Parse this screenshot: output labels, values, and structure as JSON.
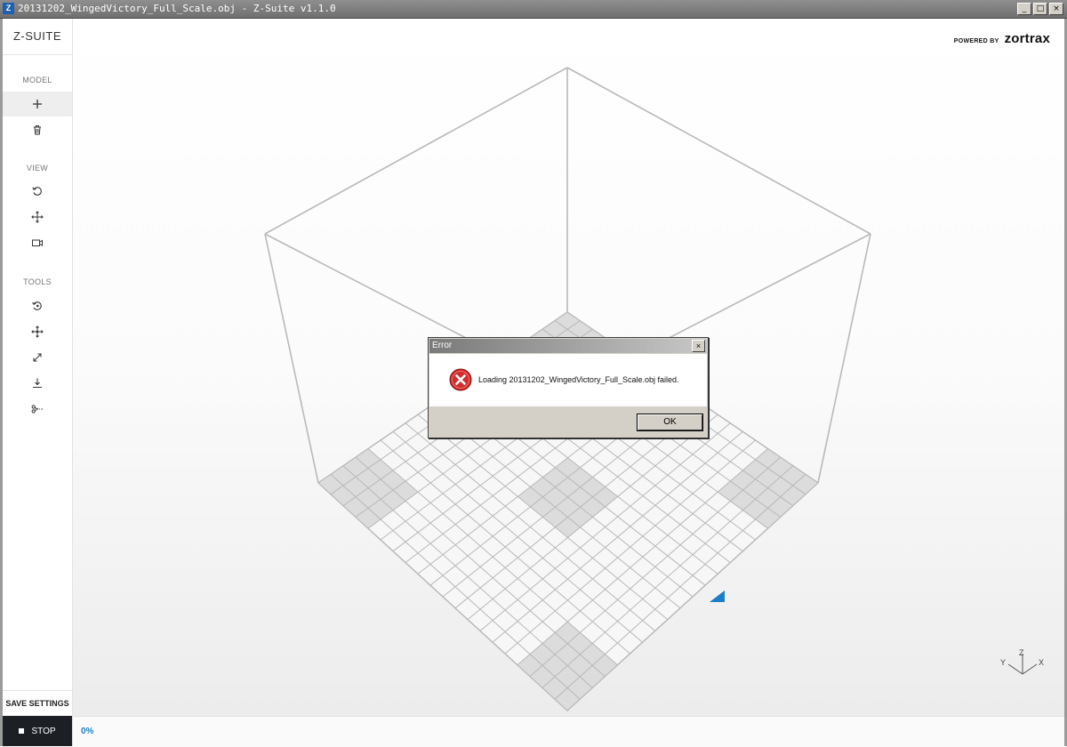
{
  "window": {
    "app_icon_letter": "Z",
    "title": "20131202_WingedVictory_Full_Scale.obj - Z-Suite v1.1.0",
    "minimize_glyph": "_",
    "maximize_glyph": "□",
    "close_glyph": "×"
  },
  "sidebar": {
    "logo": "Z-SUITE",
    "sections": {
      "model": "MODEL",
      "view": "VIEW",
      "tools": "TOOLS"
    },
    "icons": {
      "add": "plus-icon",
      "delete": "trash-icon",
      "rotate_view": "rotate-view-icon",
      "pan_view": "move-view-icon",
      "camera": "camera-icon",
      "rotate_tool": "rotate-tool-icon",
      "move_tool": "move-tool-icon",
      "scale_tool": "scale-tool-icon",
      "place_on_bed": "place-on-bed-icon",
      "cut_tool": "scissors-icon"
    },
    "save_settings": "SAVE SETTINGS",
    "stop": "STOP"
  },
  "header": {
    "powered_by": "POWERED BY",
    "brand": "zortrax"
  },
  "status": {
    "progress": "0%"
  },
  "axis_gizmo": {
    "labels": [
      "Y",
      "Z",
      "X"
    ]
  },
  "dialog": {
    "title": "Error",
    "close_glyph": "×",
    "message": "Loading 20131202_WingedVictory_Full_Scale.obj failed.",
    "ok_label": "OK",
    "icon": "error-icon",
    "icon_color": "#d22d2d"
  },
  "colors": {
    "accent": "#1a7fc6",
    "stop_button": "#1c1f24"
  }
}
